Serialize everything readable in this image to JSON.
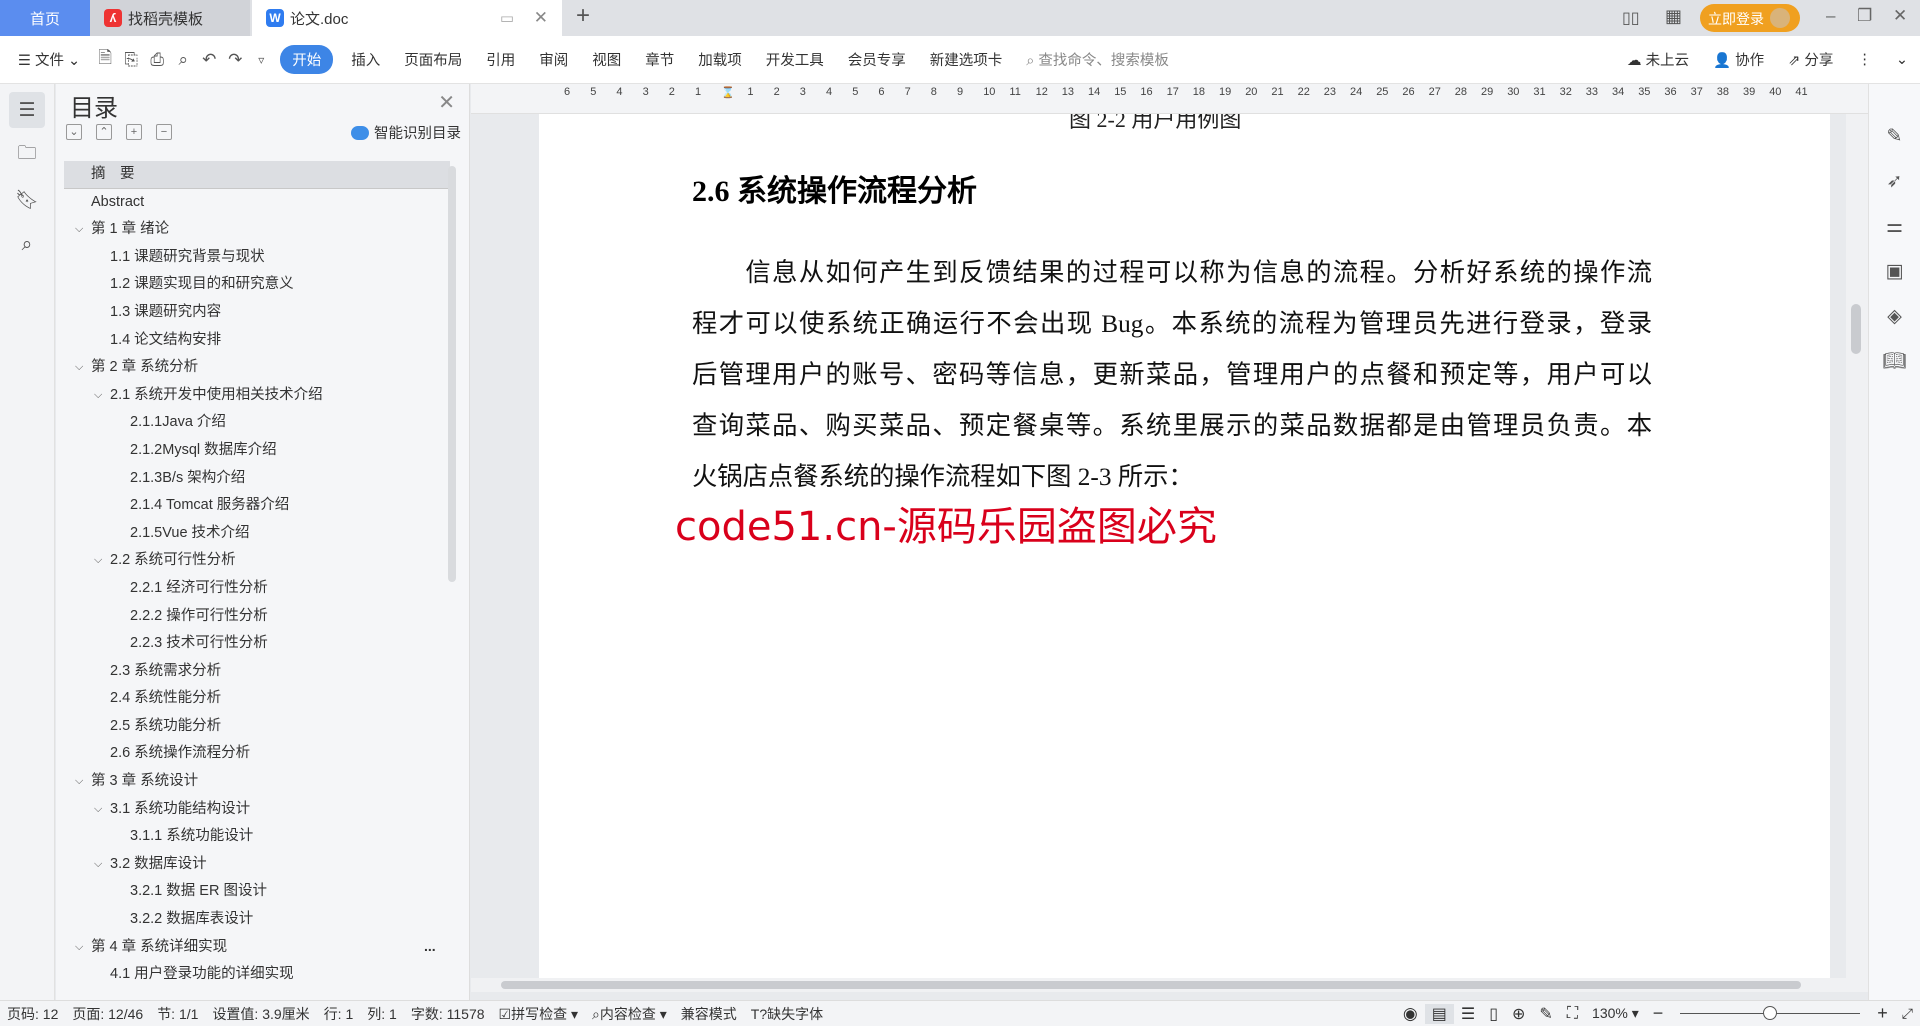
{
  "tabs": {
    "home": "首页",
    "template": "找稻壳模板",
    "doc": "论文.doc",
    "new_tab": "+"
  },
  "window": {
    "login": "立即登录",
    "minimize": "–",
    "restore": "❐",
    "close": "✕"
  },
  "toolbar": {
    "file": "文件",
    "menus": [
      "开始",
      "插入",
      "页面布局",
      "引用",
      "审阅",
      "视图",
      "章节",
      "加载项",
      "开发工具",
      "会员专享",
      "新建选项卡"
    ],
    "search_placeholder": "查找命令、搜索模板",
    "cloud": "未上云",
    "collab": "协作",
    "share": "分享"
  },
  "toc": {
    "title": "目录",
    "smart": "智能识别目录",
    "items": [
      {
        "t": "摘　要",
        "l": 0,
        "sel": true
      },
      {
        "t": "Abstract",
        "l": 0
      },
      {
        "t": "第 1 章  绪论",
        "l": 0,
        "exp": true
      },
      {
        "t": "1.1 课题研究背景与现状",
        "l": 1
      },
      {
        "t": "1.2 课题实现目的和研究意义",
        "l": 1
      },
      {
        "t": "1.3 课题研究内容",
        "l": 1
      },
      {
        "t": "1.4 论文结构安排",
        "l": 1
      },
      {
        "t": "第 2 章  系统分析",
        "l": 0,
        "exp": true
      },
      {
        "t": "2.1 系统开发中使用相关技术介绍",
        "l": 1,
        "exp": true
      },
      {
        "t": "2.1.1Java 介绍",
        "l": 2
      },
      {
        "t": "2.1.2Mysql 数据库介绍",
        "l": 2
      },
      {
        "t": "2.1.3B/s 架构介绍",
        "l": 2
      },
      {
        "t": "2.1.4 Tomcat 服务器介绍",
        "l": 2
      },
      {
        "t": "2.1.5Vue 技术介绍",
        "l": 2
      },
      {
        "t": "2.2 系统可行性分析",
        "l": 1,
        "exp": true
      },
      {
        "t": "2.2.1 经济可行性分析",
        "l": 2
      },
      {
        "t": "2.2.2 操作可行性分析",
        "l": 2
      },
      {
        "t": "2.2.3 技术可行性分析",
        "l": 2
      },
      {
        "t": "2.3 系统需求分析",
        "l": 1
      },
      {
        "t": "2.4 系统性能分析",
        "l": 1
      },
      {
        "t": "2.5 系统功能分析",
        "l": 1
      },
      {
        "t": "2.6 系统操作流程分析",
        "l": 1
      },
      {
        "t": "第 3 章  系统设计",
        "l": 0,
        "exp": true
      },
      {
        "t": "3.1 系统功能结构设计",
        "l": 1,
        "exp": true
      },
      {
        "t": "3.1.1 系统功能设计",
        "l": 2
      },
      {
        "t": "3.2 数据库设计",
        "l": 1,
        "exp": true
      },
      {
        "t": "3.2.1 数据 ER 图设计",
        "l": 2
      },
      {
        "t": "3.2.2 数据库表设计",
        "l": 2
      },
      {
        "t": "第 4 章  系统详细实现",
        "l": 0,
        "exp": true
      },
      {
        "t": "4.1 用户登录功能的详细实现",
        "l": 1
      }
    ],
    "more": "..."
  },
  "ruler": [
    "6",
    "5",
    "4",
    "3",
    "2",
    "1",
    "",
    "1",
    "2",
    "3",
    "4",
    "5",
    "6",
    "7",
    "8",
    "9",
    "10",
    "11",
    "12",
    "13",
    "14",
    "15",
    "16",
    "17",
    "18",
    "19",
    "20",
    "21",
    "22",
    "23",
    "24",
    "25",
    "26",
    "27",
    "28",
    "29",
    "30",
    "31",
    "32",
    "33",
    "34",
    "35",
    "36",
    "37",
    "38",
    "39",
    "40",
    "41"
  ],
  "document": {
    "caption": "图 2-2 用户用例图",
    "heading": "2.6 系统操作流程分析",
    "lines": [
      "　　信息从如何产生到反馈结果的过程可以称为信息的流程。分析好系统的操作流",
      "程才可以使系统正确运行不会出现 Bug。本系统的流程为管理员先进行登录，登录",
      "后管理用户的账号、密码等信息，更新菜品，管理用户的点餐和预定等，用户可以",
      "查询菜品、购买菜品、预定餐桌等。系统里展示的菜品数据都是由管理员负责。本",
      "火锅店点餐系统的操作流程如下图 2-3 所示："
    ],
    "watermark": "code51.cn-源码乐园盗图必究"
  },
  "status": {
    "page_no": "页码: 12",
    "pages": "页面: 12/46",
    "section": "节: 1/1",
    "setting": "设置值: 3.9厘米",
    "row": "行: 1",
    "col": "列: 1",
    "words": "字数: 11578",
    "spell": "拼写检查",
    "content": "内容检查",
    "compat": "兼容模式",
    "missing_font": "缺失字体",
    "zoom": "130%",
    "zoom_level": 130
  },
  "colors": {
    "accent": "#3d85e6",
    "login": "#f0a020",
    "watermark": "#d9001b"
  }
}
